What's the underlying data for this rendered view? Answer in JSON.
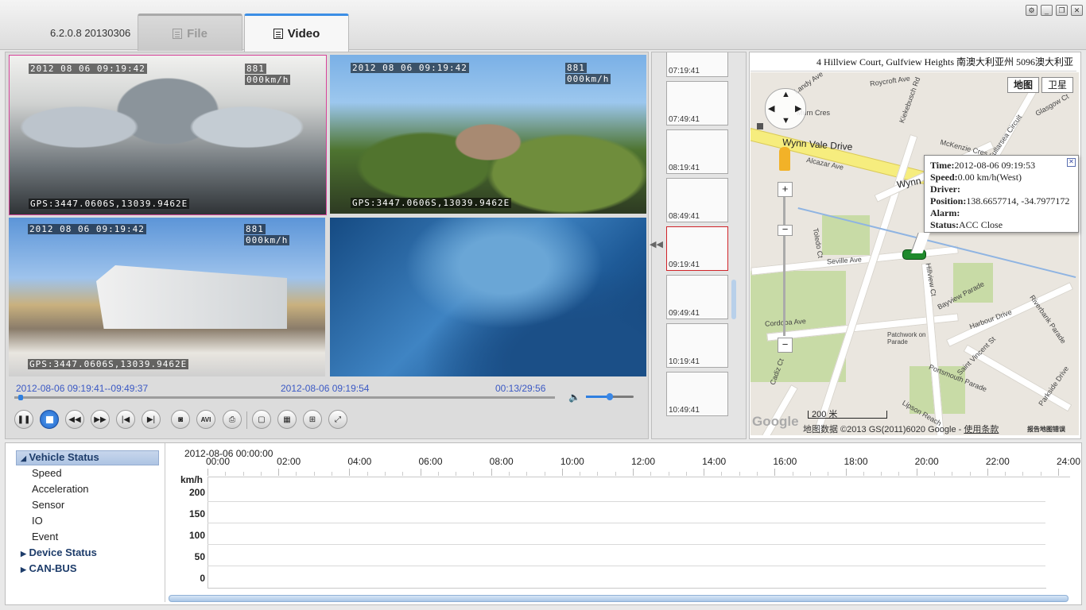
{
  "app": {
    "version": "6.2.0.8 20130306",
    "tabs": [
      {
        "label": "File"
      },
      {
        "label": "Video"
      }
    ],
    "active_tab": "Video"
  },
  "cameras": [
    {
      "date": "2012 08 06 09:19:42",
      "id": "881",
      "speed": "000km/h",
      "gps": "GPS:3447.0606S,13039.9462E"
    },
    {
      "date": "2012 08 06 09:19:42",
      "id": "881",
      "speed": "000km/h",
      "gps": "GPS:3447.0606S,13039.9462E"
    },
    {
      "date": "2012 08 06 09:19:42",
      "id": "881",
      "speed": "000km/h",
      "gps": "GPS:3447.0606S,13039.9462E"
    }
  ],
  "playback": {
    "range": "2012-08-06 09:19:41--09:49:37",
    "current_time": "2012-08-06 09:19:54",
    "elapsed": "00:13/29:56",
    "progress_fraction": 0.008,
    "volume_fraction": 0.5,
    "buttons": [
      "pause",
      "stop",
      "rewind",
      "fast-forward",
      "skip-start",
      "skip-end",
      "snapshot",
      "avi",
      "print",
      "layout-1",
      "layout-4",
      "layout-9",
      "fullscreen"
    ],
    "avi_label": "AVI"
  },
  "thumbnails": [
    {
      "time": "07:19:41"
    },
    {
      "time": "07:49:41"
    },
    {
      "time": "08:19:41"
    },
    {
      "time": "08:49:41"
    },
    {
      "time": "09:19:41",
      "selected": true
    },
    {
      "time": "09:49:41"
    },
    {
      "time": "10:19:41"
    },
    {
      "time": "10:49:41"
    }
  ],
  "map": {
    "address": "4 Hillview Court, Gulfview Heights 南澳大利亚州 5096澳大利亚",
    "map_type_buttons": [
      "地图",
      "卫星"
    ],
    "roads": [
      "Wynn Vale Drive",
      "Wynn",
      "Alcazar Ave",
      "Seville Ave",
      "Cordoba Ave",
      "Toledo Ct",
      "Hillview Ct",
      "Bayview Parade",
      "Harbour Drive",
      "Saint Vincent St",
      "Portsmouth Parade",
      "Kiekebusch Rd",
      "McKenzie Cres",
      "Landy Ave",
      "Roycroft Ave",
      "Glasgow Ct",
      "Parkside Drive",
      "Riverbank Parade",
      "Lipson Reach",
      "Cadiz Ct",
      "Murn Cres",
      "Fullarsea Circuit",
      "Patchwork on Parade"
    ],
    "popup": {
      "time_label": "Time:",
      "time": "2012-08-06 09:19:53",
      "speed_label": "Speed:",
      "speed": "0.00 km/h(West)",
      "driver_label": "Driver:",
      "driver": "",
      "position_label": "Position:",
      "position": "138.6657714, -34.7977172",
      "alarm_label": "Alarm:",
      "alarm": "",
      "status_label": "Status:",
      "status": "ACC Close"
    },
    "scale": "200 米",
    "attribution": "地图数据 ©2013 GS(2011)6020 Google - ",
    "terms": "使用条款",
    "report": "报告地图错误",
    "google": "Google"
  },
  "tree": {
    "vehicle_status": "Vehicle Status",
    "children": [
      "Speed",
      "Acceleration",
      "Sensor",
      "IO",
      "Event"
    ],
    "device_status": "Device Status",
    "canbus": "CAN-BUS"
  },
  "timeline": {
    "date": "2012-08-06 00:00:00",
    "hours": [
      "00:00",
      "02:00",
      "04:00",
      "06:00",
      "08:00",
      "10:00",
      "12:00",
      "14:00",
      "16:00",
      "18:00",
      "20:00",
      "22:00",
      "24:00"
    ],
    "unit": "km/h",
    "y_ticks": [
      "200",
      "150",
      "100",
      "50",
      "0"
    ]
  }
}
